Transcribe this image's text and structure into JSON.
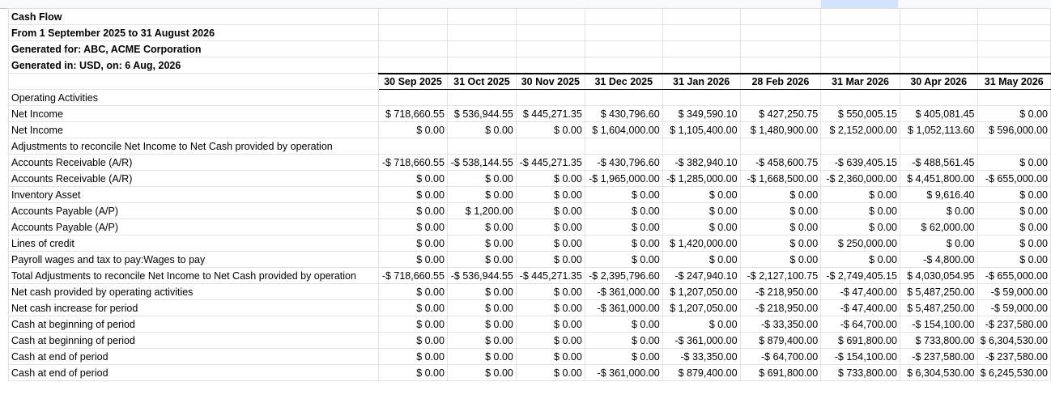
{
  "report": {
    "title": "Cash Flow",
    "period": "From 1 September 2025 to 31 August 2026",
    "generated_for": "Generated for: ABC, ACME Corporation",
    "generated_in": "Generated in: USD, on: 6 Aug, 2026"
  },
  "columns": [
    "30 Sep 2025",
    "31 Oct 2025",
    "30 Nov 2025",
    "31 Dec 2025",
    "31 Jan 2026",
    "28 Feb 2026",
    "31 Mar 2026",
    "30 Apr 2026",
    "31 May 2026"
  ],
  "rows": [
    {
      "label": "Operating Activities",
      "values": []
    },
    {
      "label": "Net Income",
      "values": [
        "$ 718,660.55",
        "$ 536,944.55",
        "$ 445,271.35",
        "$ 430,796.60",
        "$ 349,590.10",
        "$ 427,250.75",
        "$ 550,005.15",
        "$ 405,081.45",
        "$ 0.00"
      ]
    },
    {
      "label": "Net Income",
      "values": [
        "$ 0.00",
        "$ 0.00",
        "$ 0.00",
        "$ 1,604,000.00",
        "$ 1,105,400.00",
        "$ 1,480,900.00",
        "$ 2,152,000.00",
        "$ 1,052,113.60",
        "$ 596,000.00"
      ]
    },
    {
      "label": "Adjustments to reconcile Net Income to Net Cash provided by operation",
      "values": []
    },
    {
      "label": "Accounts Receivable (A/R)",
      "values": [
        "-$ 718,660.55",
        "-$ 538,144.55",
        "-$ 445,271.35",
        "-$ 430,796.60",
        "-$ 382,940.10",
        "-$ 458,600.75",
        "-$ 639,405.15",
        "-$ 488,561.45",
        "$ 0.00"
      ]
    },
    {
      "label": "Accounts Receivable (A/R)",
      "values": [
        "$ 0.00",
        "$ 0.00",
        "$ 0.00",
        "-$ 1,965,000.00",
        "-$ 1,285,000.00",
        "-$ 1,668,500.00",
        "-$ 2,360,000.00",
        "$ 4,451,800.00",
        "-$ 655,000.00"
      ]
    },
    {
      "label": "Inventory Asset",
      "values": [
        "$ 0.00",
        "$ 0.00",
        "$ 0.00",
        "$ 0.00",
        "$ 0.00",
        "$ 0.00",
        "$ 0.00",
        "$ 9,616.40",
        "$ 0.00"
      ]
    },
    {
      "label": "Accounts Payable (A/P)",
      "values": [
        "$ 0.00",
        "$ 1,200.00",
        "$ 0.00",
        "$ 0.00",
        "$ 0.00",
        "$ 0.00",
        "$ 0.00",
        "$ 0.00",
        "$ 0.00"
      ]
    },
    {
      "label": "Accounts Payable (A/P)",
      "values": [
        "$ 0.00",
        "$ 0.00",
        "$ 0.00",
        "$ 0.00",
        "$ 0.00",
        "$ 0.00",
        "$ 0.00",
        "$ 62,000.00",
        "$ 0.00"
      ]
    },
    {
      "label": "Lines of credit",
      "values": [
        "$ 0.00",
        "$ 0.00",
        "$ 0.00",
        "$ 0.00",
        "$ 1,420,000.00",
        "$ 0.00",
        "$ 250,000.00",
        "$ 0.00",
        "$ 0.00"
      ]
    },
    {
      "label": "Payroll wages and tax to pay:Wages to pay",
      "values": [
        "$ 0.00",
        "$ 0.00",
        "$ 0.00",
        "$ 0.00",
        "$ 0.00",
        "$ 0.00",
        "$ 0.00",
        "-$ 4,800.00",
        "$ 0.00"
      ]
    },
    {
      "label": "Total Adjustments to reconcile Net Income to Net Cash provided by operation",
      "values": [
        "-$ 718,660.55",
        "-$ 536,944.55",
        "-$ 445,271.35",
        "-$ 2,395,796.60",
        "-$ 247,940.10",
        "-$ 2,127,100.75",
        "-$ 2,749,405.15",
        "$ 4,030,054.95",
        "-$ 655,000.00"
      ]
    },
    {
      "label": "Net cash provided by operating activities",
      "values": [
        "$ 0.00",
        "$ 0.00",
        "$ 0.00",
        "-$ 361,000.00",
        "$ 1,207,050.00",
        "-$ 218,950.00",
        "-$ 47,400.00",
        "$ 5,487,250.00",
        "-$ 59,000.00"
      ]
    },
    {
      "label": "Net cash increase for period",
      "values": [
        "$ 0.00",
        "$ 0.00",
        "$ 0.00",
        "-$ 361,000.00",
        "$ 1,207,050.00",
        "-$ 218,950.00",
        "-$ 47,400.00",
        "$ 5,487,250.00",
        "-$ 59,000.00"
      ]
    },
    {
      "label": "Cash at beginning of period",
      "values": [
        "$ 0.00",
        "$ 0.00",
        "$ 0.00",
        "$ 0.00",
        "$ 0.00",
        "-$ 33,350.00",
        "-$ 64,700.00",
        "-$ 154,100.00",
        "-$ 237,580.00"
      ]
    },
    {
      "label": "Cash at beginning of period",
      "values": [
        "$ 0.00",
        "$ 0.00",
        "$ 0.00",
        "$ 0.00",
        "-$ 361,000.00",
        "$ 879,400.00",
        "$ 691,800.00",
        "$ 733,800.00",
        "$ 6,304,530.00"
      ]
    },
    {
      "label": "Cash at end of period",
      "values": [
        "$ 0.00",
        "$ 0.00",
        "$ 0.00",
        "$ 0.00",
        "-$ 33,350.00",
        "-$ 64,700.00",
        "-$ 154,100.00",
        "-$ 237,580.00",
        "-$ 237,580.00"
      ]
    },
    {
      "label": "Cash at end of period",
      "values": [
        "$ 0.00",
        "$ 0.00",
        "$ 0.00",
        "-$ 361,000.00",
        "$ 879,400.00",
        "$ 691,800.00",
        "$ 733,800.00",
        "$ 6,304,530.00",
        "$ 6,245,530.00"
      ]
    }
  ]
}
